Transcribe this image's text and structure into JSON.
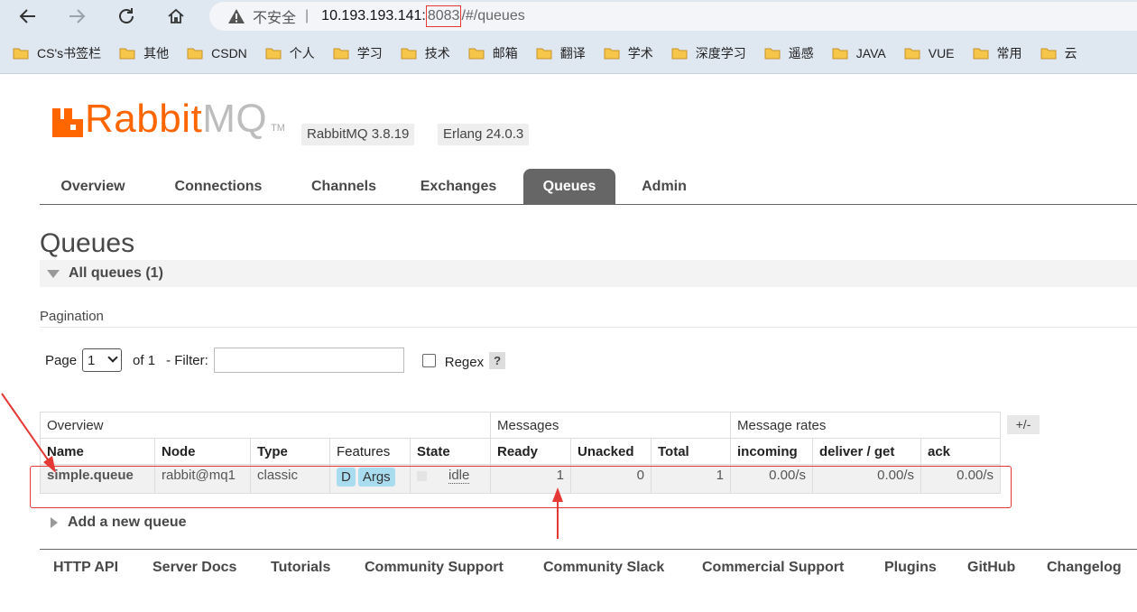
{
  "browser": {
    "insecure_label": "不安全",
    "separator": "|",
    "host": "10.193.193.141:",
    "port": "8083",
    "path": "/#/queues",
    "bookmarks": [
      "CS's书签栏",
      "其他",
      "CSDN",
      "个人",
      "学习",
      "技术",
      "邮箱",
      "翻译",
      "学术",
      "深度学习",
      "遥感",
      "JAVA",
      "VUE",
      "常用",
      "云"
    ]
  },
  "header": {
    "logo_rabbit": "Rabbit",
    "logo_mq": "MQ",
    "logo_tm": "TM",
    "version_rabbitmq": "RabbitMQ 3.8.19",
    "version_erlang": "Erlang 24.0.3"
  },
  "tabs": [
    "Overview",
    "Connections",
    "Channels",
    "Exchanges",
    "Queues",
    "Admin"
  ],
  "active_tab": "Queues",
  "page": {
    "title": "Queues",
    "section": "All queues (1)",
    "pagination_label": "Pagination",
    "page_label": "Page",
    "page_value": "1",
    "of_label": "of 1",
    "filter_label": "- Filter:",
    "regex_label": "Regex",
    "help_label": "?"
  },
  "table": {
    "groups": [
      "Overview",
      "Messages",
      "Message rates"
    ],
    "plus_minus": "+/-",
    "columns": [
      "Name",
      "Node",
      "Type",
      "Features",
      "State",
      "Ready",
      "Unacked",
      "Total",
      "incoming",
      "deliver / get",
      "ack"
    ],
    "rows": [
      {
        "name": "simple.queue",
        "node": "rabbit@mq1",
        "type": "classic",
        "feature_d": "D",
        "feature_args": "Args",
        "state": "idle",
        "ready": "1",
        "unacked": "0",
        "total": "1",
        "incoming": "0.00/s",
        "deliver_get": "0.00/s",
        "ack": "0.00/s"
      }
    ]
  },
  "add_queue": "Add a new queue",
  "footer": [
    "HTTP API",
    "Server Docs",
    "Tutorials",
    "Community Support",
    "Community Slack",
    "Commercial Support",
    "Plugins",
    "GitHub",
    "Changelog"
  ],
  "colors": {
    "brand": "#ff6600",
    "annotation": "#e53935",
    "active_tab": "#666666",
    "feature_badge": "#aadcf0"
  }
}
